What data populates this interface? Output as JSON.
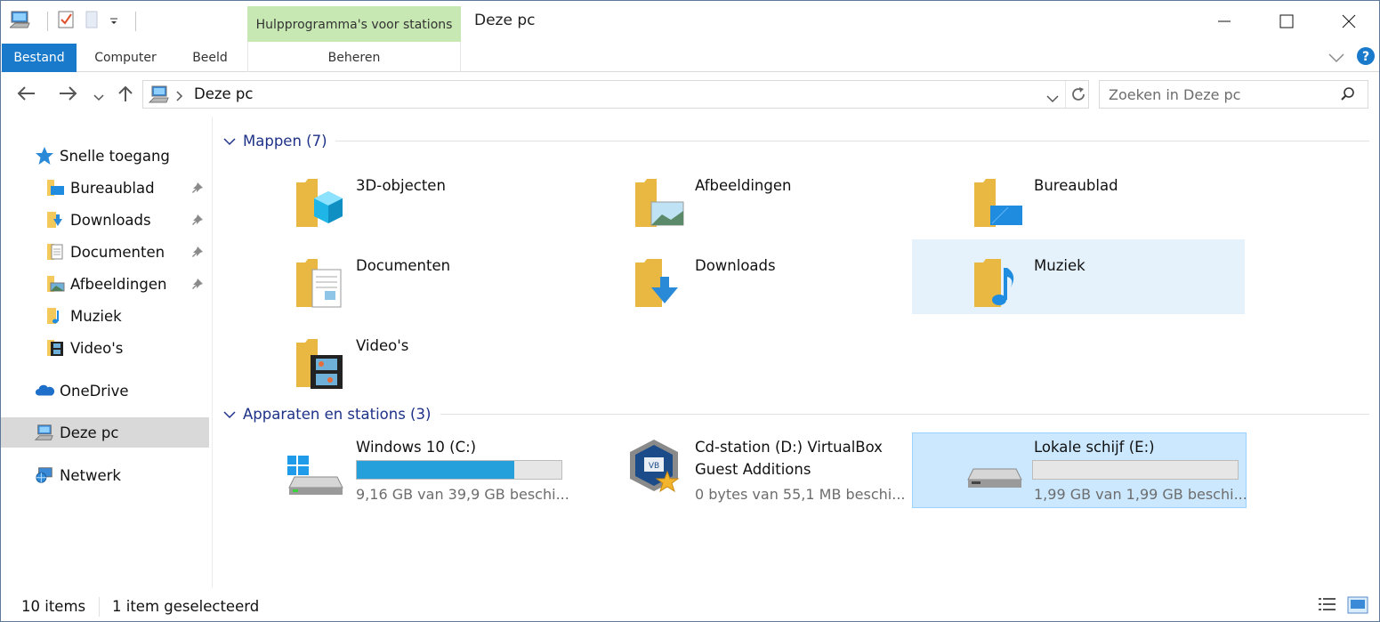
{
  "window": {
    "title": "Deze pc",
    "context_tab_group": "Hulpprogramma's voor stations",
    "colors": {
      "accent": "#1979ca",
      "context_tab": "#c7e8b2",
      "selection": "#cce8ff",
      "hover": "#e5f1fb",
      "progress": "#26a0da"
    }
  },
  "ribbon": {
    "tabs": [
      {
        "label": "Bestand"
      },
      {
        "label": "Computer"
      },
      {
        "label": "Beeld"
      },
      {
        "label": "Beheren"
      }
    ]
  },
  "address": {
    "path": "Deze pc"
  },
  "search": {
    "placeholder": "Zoeken in Deze pc"
  },
  "sidebar": {
    "items": [
      {
        "label": "Snelle toegang",
        "icon": "star-icon"
      },
      {
        "label": "Bureaublad",
        "icon": "desktop-folder-icon",
        "pinned": true
      },
      {
        "label": "Downloads",
        "icon": "downloads-folder-icon",
        "pinned": true
      },
      {
        "label": "Documenten",
        "icon": "documents-folder-icon",
        "pinned": true
      },
      {
        "label": "Afbeeldingen",
        "icon": "pictures-folder-icon",
        "pinned": true
      },
      {
        "label": "Muziek",
        "icon": "music-folder-icon"
      },
      {
        "label": "Video's",
        "icon": "videos-folder-icon"
      },
      {
        "label": "OneDrive",
        "icon": "cloud-icon"
      },
      {
        "label": "Deze pc",
        "icon": "computer-icon",
        "selected": true
      },
      {
        "label": "Netwerk",
        "icon": "network-icon"
      }
    ]
  },
  "folders": {
    "header": "Mappen (7)",
    "items": [
      {
        "label": "3D-objecten",
        "icon": "3d-objects-folder-icon"
      },
      {
        "label": "Afbeeldingen",
        "icon": "pictures-folder-icon"
      },
      {
        "label": "Bureaublad",
        "icon": "desktop-folder-icon"
      },
      {
        "label": "Documenten",
        "icon": "documents-folder-icon"
      },
      {
        "label": "Downloads",
        "icon": "downloads-folder-icon"
      },
      {
        "label": "Muziek",
        "icon": "music-folder-icon"
      },
      {
        "label": "Video's",
        "icon": "videos-folder-icon"
      }
    ]
  },
  "drives": {
    "header": "Apparaten en stations (3)",
    "items": [
      {
        "label": "Windows 10 (C:)",
        "sub": "9,16 GB van 39,9 GB beschi...",
        "used_fraction": 0.77,
        "icon": "windows-drive-icon"
      },
      {
        "label": "Cd-station (D:) VirtualBox Guest Additions",
        "label_line1": "Cd-station (D:) VirtualBox",
        "label_line2": "Guest Additions",
        "sub": "0 bytes van 55,1 MB beschi...",
        "icon": "virtualbox-cd-icon"
      },
      {
        "label": "Lokale schijf (E:)",
        "sub": "1,99 GB van 1,99 GB beschi...",
        "used_fraction": 0.0,
        "icon": "hard-drive-icon"
      }
    ]
  },
  "status": {
    "count": "10 items",
    "selection": "1 item geselecteerd"
  }
}
